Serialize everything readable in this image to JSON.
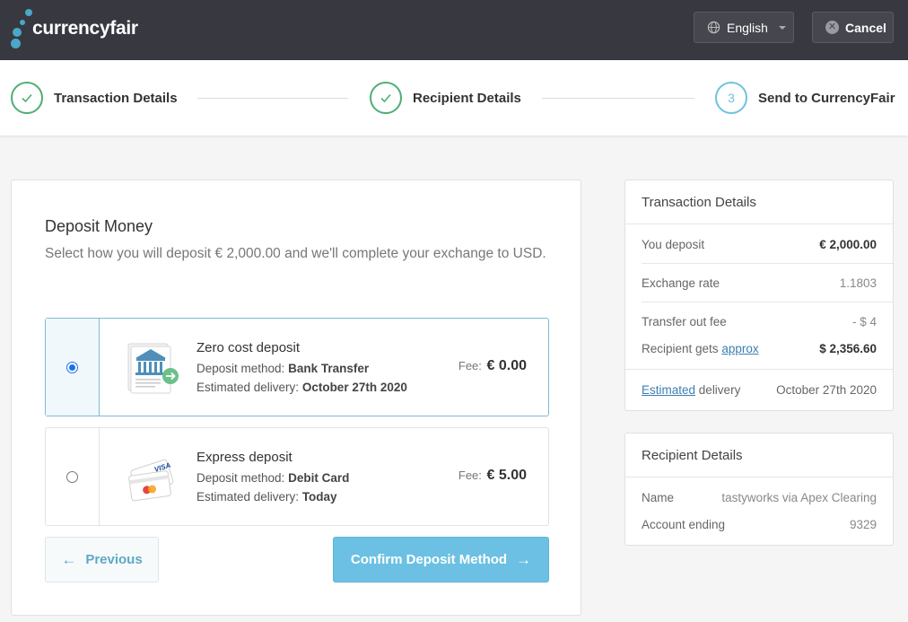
{
  "header": {
    "logo_text": "currencyfair",
    "language_label": "English",
    "cancel_label": "Cancel"
  },
  "stepper": {
    "steps": [
      {
        "label": "Transaction Details",
        "state": "complete"
      },
      {
        "label": "Recipient Details",
        "state": "complete"
      },
      {
        "label": "Send to CurrencyFair",
        "state": "current",
        "number": "3"
      }
    ]
  },
  "deposit": {
    "title": "Deposit Money",
    "subtitle": "Select how you will deposit € 2,000.00 and we'll complete your exchange to USD.",
    "options": [
      {
        "title": "Zero cost deposit",
        "method_label": "Deposit method:",
        "method_value": "Bank Transfer",
        "delivery_label": "Estimated delivery:",
        "delivery_value": "October 27th 2020",
        "fee_label": "Fee:",
        "fee_value": "€ 0.00",
        "selected": true,
        "icon": "bank-transfer-icon"
      },
      {
        "title": "Express deposit",
        "method_label": "Deposit method:",
        "method_value": "Debit Card",
        "delivery_label": "Estimated delivery:",
        "delivery_value": "Today",
        "fee_label": "Fee:",
        "fee_value": "€ 5.00",
        "selected": false,
        "icon": "debit-card-icon"
      }
    ],
    "previous_label": "Previous",
    "confirm_label": "Confirm Deposit Method"
  },
  "transaction_details": {
    "title": "Transaction Details",
    "you_deposit_label": "You deposit",
    "you_deposit_value": "€ 2,000.00",
    "exchange_rate_label": "Exchange rate",
    "exchange_rate_value": "1.1803",
    "transfer_fee_label": "Transfer out fee",
    "transfer_fee_value": "- $ 4",
    "recipient_gets_label": "Recipient gets",
    "recipient_gets_link": "approx",
    "recipient_gets_value": "$ 2,356.60",
    "estimated_link": "Estimated",
    "delivery_label": "delivery",
    "delivery_value": "October 27th 2020"
  },
  "recipient_details": {
    "title": "Recipient Details",
    "name_label": "Name",
    "name_value": "tastyworks via Apex Clearing",
    "account_label": "Account ending",
    "account_value": "9329"
  },
  "colors": {
    "header_bg": "#373840",
    "accent": "#6cc0e3",
    "success": "#4caf73",
    "link": "#3b7fb0"
  }
}
